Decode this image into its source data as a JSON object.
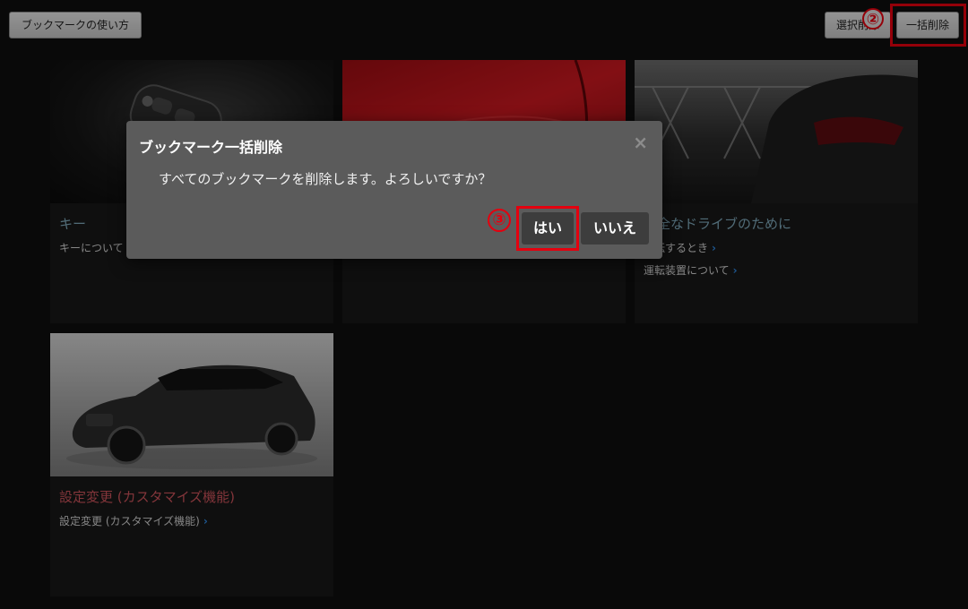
{
  "toolbar": {
    "howto_label": "ブックマークの使い方",
    "select_delete_label": "選択削除",
    "bulk_delete_label": "一括削除"
  },
  "annotations": {
    "step2": "②",
    "step3": "③"
  },
  "cards": [
    {
      "title": "キー",
      "links": [
        "キーについて"
      ]
    },
    {
      "title": "",
      "links": []
    },
    {
      "title": "安全なドライブのために",
      "links": [
        "運転するとき",
        "運転装置について"
      ]
    },
    {
      "title": "設定変更 (カスタマイズ機能)",
      "links": [
        "設定変更 (カスタマイズ機能)"
      ]
    }
  ],
  "dialog": {
    "title": "ブックマーク一括削除",
    "message": "すべてのブックマークを削除します。よろしいですか？",
    "yes_label": "はい",
    "no_label": "いいえ",
    "close_glyph": "×"
  },
  "colors": {
    "highlight_red": "#e4000f",
    "link_chevron": "#2e86de"
  }
}
